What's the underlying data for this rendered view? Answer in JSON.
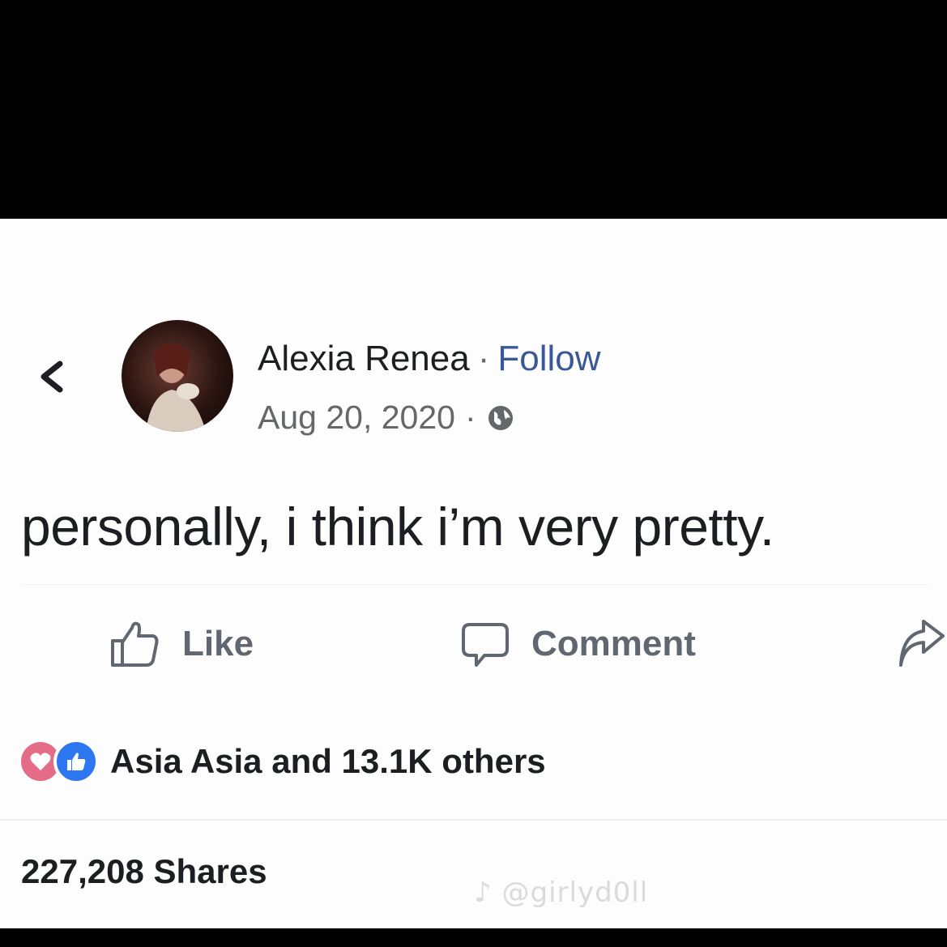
{
  "post": {
    "author_name": "Alexia Renea",
    "separator": "·",
    "follow_label": "Follow",
    "date": "Aug 20, 2020",
    "meta_separator": "·",
    "privacy_icon": "globe-icon",
    "text": "personally, i think i’m very pretty."
  },
  "actions": {
    "like_label": "Like",
    "comment_label": "Comment",
    "like_icon": "thumbs-up-icon",
    "comment_icon": "speech-bubble-icon",
    "share_icon": "share-arrow-icon"
  },
  "reactions": {
    "icons": [
      "heart-reaction-icon",
      "like-reaction-icon"
    ],
    "summary": "Asia Asia and 13.1K others",
    "colors": {
      "heart": "#e46c86",
      "like": "#2d78f0"
    }
  },
  "shares": {
    "text": "227,208 Shares"
  },
  "watermark": {
    "text": "@girlyd0ll",
    "icon": "tiktok-icon"
  },
  "colors": {
    "link": "#385898",
    "text": "#1c1e21",
    "muted": "#65676b"
  }
}
